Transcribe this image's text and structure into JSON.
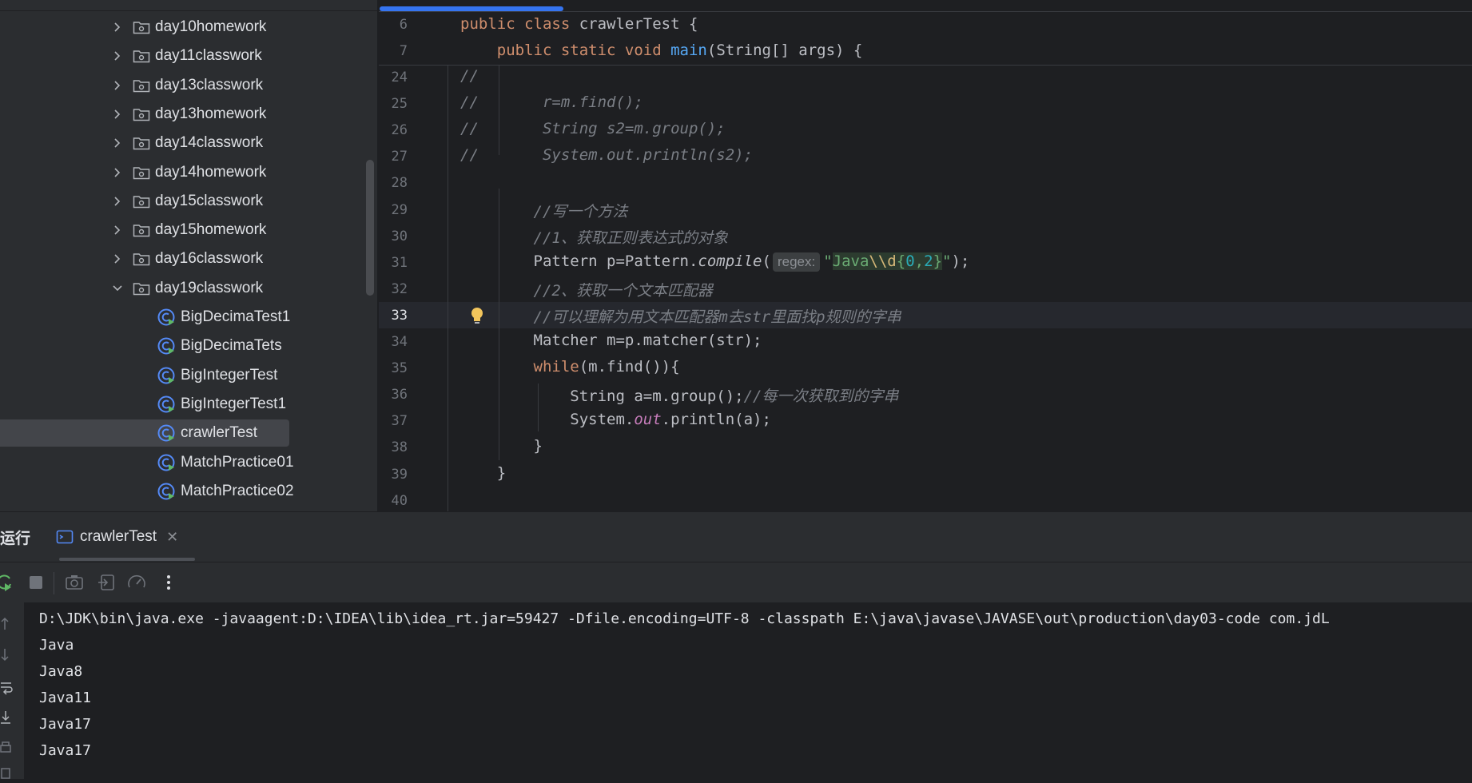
{
  "project_tree": {
    "items": [
      {
        "label": "day10homework",
        "kind": "folder"
      },
      {
        "label": "day11classwork",
        "kind": "folder"
      },
      {
        "label": "day13classwork",
        "kind": "folder"
      },
      {
        "label": "day13homework",
        "kind": "folder"
      },
      {
        "label": "day14classwork",
        "kind": "folder"
      },
      {
        "label": "day14homework",
        "kind": "folder"
      },
      {
        "label": "day15classwork",
        "kind": "folder"
      },
      {
        "label": "day15homework",
        "kind": "folder"
      },
      {
        "label": "day16classwork",
        "kind": "folder"
      },
      {
        "label": "day19classwork",
        "kind": "folder-open"
      },
      {
        "label": "BigDecimaTest1",
        "kind": "class"
      },
      {
        "label": "BigDecimaTets",
        "kind": "class"
      },
      {
        "label": "BigIntegerTest",
        "kind": "class"
      },
      {
        "label": "BigIntegerTest1",
        "kind": "class"
      },
      {
        "label": "crawlerTest",
        "kind": "class",
        "selected": true
      },
      {
        "label": "MatchPractice01",
        "kind": "class"
      },
      {
        "label": "MatchPractice02",
        "kind": "class"
      }
    ]
  },
  "editor": {
    "sticky_lines": [
      {
        "num": "6",
        "parts": [
          {
            "t": "public class ",
            "c": "kw"
          },
          {
            "t": "crawlerTest {",
            "c": ""
          }
        ]
      },
      {
        "num": "7",
        "parts": [
          {
            "t": "    public static void ",
            "c": "kw"
          },
          {
            "t": "main",
            "c": "fn"
          },
          {
            "t": "(String[] args) {",
            "c": ""
          }
        ]
      }
    ],
    "lines": [
      {
        "num": "24",
        "parts": [
          {
            "t": "//",
            "c": "cm"
          }
        ]
      },
      {
        "num": "25",
        "parts": [
          {
            "t": "//       r=m.find();",
            "c": "cm"
          }
        ]
      },
      {
        "num": "26",
        "parts": [
          {
            "t": "//       String s2=m.group();",
            "c": "cm"
          }
        ]
      },
      {
        "num": "27",
        "parts": [
          {
            "t": "//       System.out.println(s2);",
            "c": "cm"
          }
        ]
      },
      {
        "num": "28",
        "parts": []
      },
      {
        "num": "29",
        "parts": [
          {
            "t": "        //写一个方法",
            "c": "cm"
          }
        ]
      },
      {
        "num": "30",
        "parts": [
          {
            "t": "        //1、获取正则表达式的对象",
            "c": "cm"
          }
        ]
      },
      {
        "num": "31",
        "parts": [
          {
            "t": "        Pattern p=Pattern.",
            "c": ""
          },
          {
            "t": "compile",
            "c": "it"
          },
          {
            "t": "(",
            "c": ""
          },
          {
            "t": "regex:",
            "c": "hint"
          },
          {
            "t": "\"",
            "c": "str"
          },
          {
            "t": "Java",
            "c": "regexbg"
          },
          {
            "t": "\\\\d",
            "c": "regexbg regex-esc"
          },
          {
            "t": "{",
            "c": "regexbg"
          },
          {
            "t": "0",
            "c": "regexbg regex-num"
          },
          {
            "t": ",",
            "c": "regexbg"
          },
          {
            "t": "2",
            "c": "regexbg regex-num"
          },
          {
            "t": "}",
            "c": "regexbg"
          },
          {
            "t": "\"",
            "c": "str"
          },
          {
            "t": ");",
            "c": ""
          }
        ]
      },
      {
        "num": "32",
        "parts": [
          {
            "t": "        //2、获取一个文本匹配器",
            "c": "cm"
          }
        ]
      },
      {
        "num": "33",
        "parts": [
          {
            "t": "        //可以理解为用文本匹配器m去str里面找p规则的字串",
            "c": "cm"
          }
        ],
        "current": true
      },
      {
        "num": "34",
        "parts": [
          {
            "t": "        Matcher m=p.matcher(str);",
            "c": ""
          }
        ]
      },
      {
        "num": "35",
        "parts": [
          {
            "t": "        ",
            "c": ""
          },
          {
            "t": "while",
            "c": "kw"
          },
          {
            "t": "(m.find()){",
            "c": ""
          }
        ]
      },
      {
        "num": "36",
        "parts": [
          {
            "t": "            String a=m.group();",
            "c": ""
          },
          {
            "t": "//每一次获取到的字串",
            "c": "cm"
          }
        ]
      },
      {
        "num": "37",
        "parts": [
          {
            "t": "            System.",
            "c": ""
          },
          {
            "t": "out",
            "c": "static-field"
          },
          {
            "t": ".println(a);",
            "c": ""
          }
        ]
      },
      {
        "num": "38",
        "parts": [
          {
            "t": "        }",
            "c": ""
          }
        ]
      },
      {
        "num": "39",
        "parts": [
          {
            "t": "    }",
            "c": ""
          }
        ]
      },
      {
        "num": "40",
        "parts": []
      }
    ]
  },
  "run_panel": {
    "title": "运行",
    "tab_label": "crawlerTest",
    "close_glyph": "✕",
    "console_lines": [
      "D:\\JDK\\bin\\java.exe -javaagent:D:\\IDEA\\lib\\idea_rt.jar=59427 -Dfile.encoding=UTF-8 -classpath E:\\java\\javase\\JAVASE\\out\\production\\day03-code com.jdL",
      "Java",
      "Java8",
      "Java11",
      "Java17",
      "Java17"
    ]
  },
  "colors": {
    "accent": "#3574f0",
    "background": "#1e1f22",
    "panel": "#2b2d30"
  }
}
